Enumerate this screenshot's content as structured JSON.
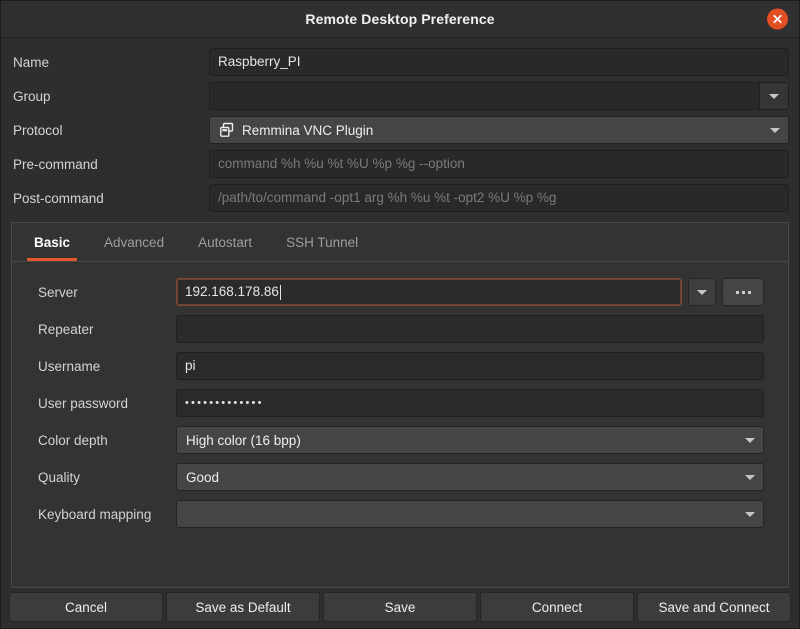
{
  "window": {
    "title": "Remote Desktop Preference",
    "close_icon": "close-icon",
    "accent_color": "#e4572b",
    "close_button_color": "#e14f22"
  },
  "top_form": {
    "rows": [
      {
        "label": "Name",
        "value": "Raspberry_PI",
        "placeholder": "",
        "widget": "entry"
      },
      {
        "label": "Group",
        "value": "",
        "placeholder": "",
        "widget": "combo-entry"
      },
      {
        "label": "Protocol",
        "value": "Remmina VNC Plugin",
        "placeholder": "",
        "widget": "combo",
        "icon": "windows-plugin-icon"
      },
      {
        "label": "Pre-command",
        "value": "",
        "placeholder": "command %h %u %t %U %p %g --option",
        "widget": "entry"
      },
      {
        "label": "Post-command",
        "value": "",
        "placeholder": "/path/to/command -opt1 arg %h %u %t -opt2 %U %p %g",
        "widget": "entry"
      }
    ]
  },
  "notebook": {
    "tabs": [
      {
        "label": "Basic",
        "active": true
      },
      {
        "label": "Advanced",
        "active": false
      },
      {
        "label": "Autostart",
        "active": false
      },
      {
        "label": "SSH Tunnel",
        "active": false
      }
    ],
    "basic": {
      "server": {
        "label": "Server",
        "value": "192.168.178.86",
        "focused": true,
        "has_dropdown": true,
        "has_browse": true,
        "browse_icon": "ellipsis-icon",
        "dropdown_icon": "chevron-down-icon"
      },
      "repeater": {
        "label": "Repeater",
        "value": ""
      },
      "username": {
        "label": "Username",
        "value": "pi"
      },
      "password": {
        "label": "User password",
        "value": "•••••••••••••",
        "masked": true
      },
      "color_depth": {
        "label": "Color depth",
        "value": "High color (16 bpp)"
      },
      "quality": {
        "label": "Quality",
        "value": "Good"
      },
      "keyboard_mapping": {
        "label": "Keyboard mapping",
        "value": ""
      }
    }
  },
  "actions": {
    "cancel": "Cancel",
    "save_as_default": "Save as Default",
    "save": "Save",
    "connect": "Connect",
    "save_and_connect": "Save and Connect"
  }
}
